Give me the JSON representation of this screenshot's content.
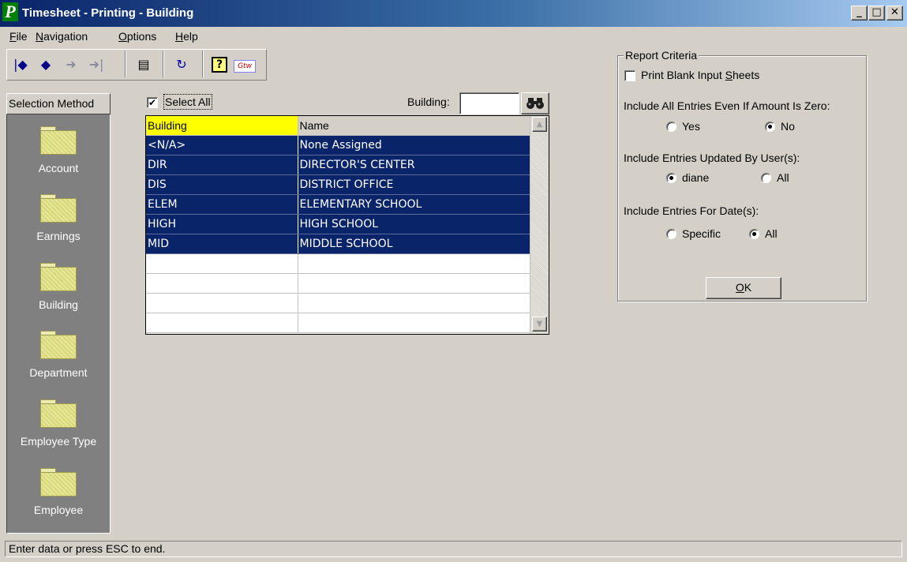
{
  "window": {
    "app_icon_letter": "P",
    "title": "Timesheet - Printing - Building",
    "minimize": "_",
    "maximize": "□",
    "close": "✕"
  },
  "menu": [
    {
      "pre": "",
      "key": "F",
      "post": "ile"
    },
    {
      "pre": "",
      "key": "N",
      "post": "avigation"
    },
    {
      "pre": "",
      "key": "O",
      "post": "ptions"
    },
    {
      "pre": "",
      "key": "H",
      "post": "elp"
    }
  ],
  "toolbar": {
    "first_icon": "|◆",
    "prev_icon": "◆",
    "next_icon": "➜",
    "last_icon": "➜|",
    "report_icon": "▤",
    "refresh_icon": "↻",
    "help_icon": "?",
    "brand_icon": "Gtw"
  },
  "selection_method": {
    "header": "Selection Method",
    "items": [
      "Account",
      "Earnings",
      "Building",
      "Department",
      "Employee Type",
      "Employee"
    ]
  },
  "grid_controls": {
    "select_all_label": "Select All",
    "select_all_checked": true,
    "building_label": "Building:",
    "building_value": "",
    "find_icon": "binoculars-icon"
  },
  "grid": {
    "columns": [
      "Building",
      "Name"
    ],
    "rows": [
      {
        "code": "<N/A>",
        "name": "None Assigned"
      },
      {
        "code": "DIR",
        "name": "DIRECTOR'S CENTER"
      },
      {
        "code": "DIS",
        "name": "DISTRICT OFFICE"
      },
      {
        "code": "ELEM",
        "name": "ELEMENTARY SCHOOL"
      },
      {
        "code": "HIGH",
        "name": "HIGH SCHOOL"
      },
      {
        "code": "MID",
        "name": "MIDDLE SCHOOL"
      },
      {
        "code": "",
        "name": ""
      },
      {
        "code": "",
        "name": ""
      },
      {
        "code": "",
        "name": ""
      },
      {
        "code": "",
        "name": ""
      }
    ],
    "selection_color": "#0a246a",
    "active_header_color": "#ffff00",
    "scroll_up": "▲",
    "scroll_down": "▼"
  },
  "report_criteria": {
    "title": "Report Criteria",
    "print_blank_pre": "Print Blank Input ",
    "print_blank_key": "S",
    "print_blank_post": "heets",
    "print_blank_checked": false,
    "include_zero_label": "Include All Entries Even If Amount Is Zero:",
    "zero_yes": "Yes",
    "zero_no": "No",
    "zero_selected": "No",
    "updated_by_label": "Include Entries Updated By User(s):",
    "user_diane": "diane",
    "user_all": "All",
    "user_selected": "diane",
    "dates_label": "Include Entries For Date(s):",
    "date_specific": "Specific",
    "date_all": "All",
    "date_selected": "All",
    "ok_key": "O",
    "ok_rest": "K"
  },
  "status": {
    "message": "Enter data or press ESC to end."
  }
}
